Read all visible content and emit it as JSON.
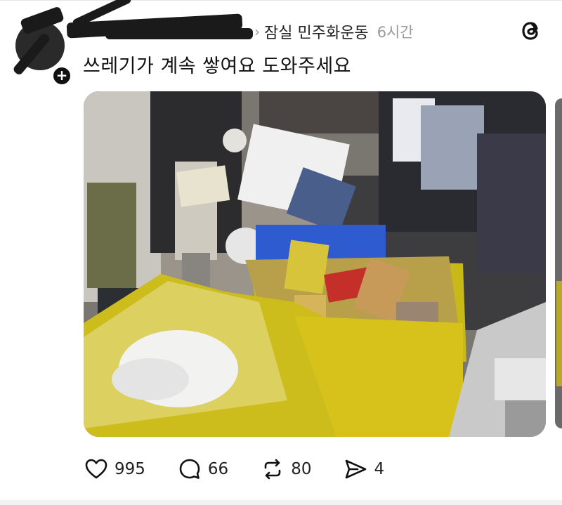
{
  "post": {
    "community": "잠실 민주화운동",
    "time": "6시간",
    "text": "쓰레기가 계속 쌓여요 도와주세요"
  },
  "stats": {
    "likes": "995",
    "comments": "66",
    "reposts": "80",
    "shares": "4"
  },
  "icons": [
    "chevron-right-icon",
    "threads-logo-icon",
    "heart-icon",
    "comment-icon",
    "repost-icon",
    "share-icon",
    "plus-icon"
  ],
  "colors": {
    "text": "#111111",
    "muted": "#9a9a9a",
    "trash_bag": "#d9c41a",
    "bin_blue": "#2f5bd0"
  }
}
